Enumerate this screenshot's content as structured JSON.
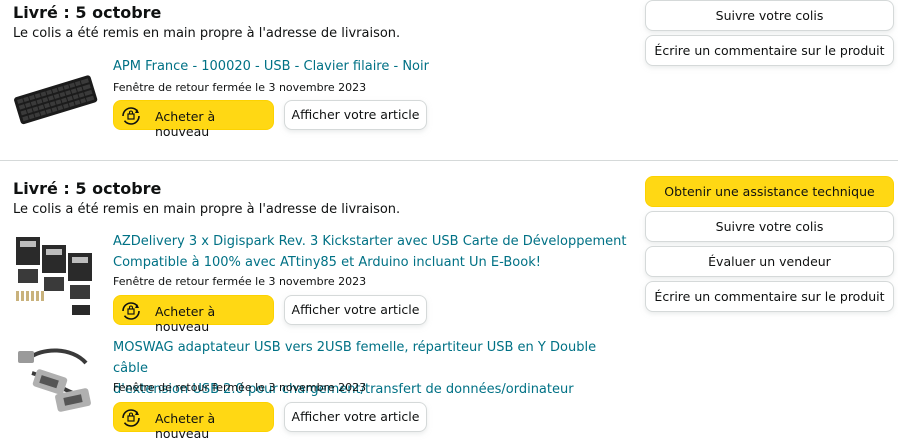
{
  "orders": [
    {
      "status": "Livré : 5 octobre",
      "status_sub": "Le colis a été remis en main propre à l'adresse de livraison.",
      "items": [
        {
          "title": "APM France - 100020 - USB - Clavier filaire - Noir",
          "return_window": "Fenêtre de retour fermée le 3 novembre 2023",
          "buy_again": "Acheter à nouveau",
          "view_item": "Afficher votre article"
        }
      ],
      "actions": [
        "Suivre votre colis",
        "Écrire un commentaire sur le produit"
      ]
    },
    {
      "status": "Livré : 5 octobre",
      "status_sub": "Le colis a été remis en main propre à l'adresse de livraison.",
      "items": [
        {
          "title_line1": "AZDelivery 3 x Digispark Rev. 3 Kickstarter avec USB Carte de Développement",
          "title_line2": "Compatible à 100% avec ATtiny85 et Arduino incluant Un E-Book!",
          "return_window": "Fenêtre de retour fermée le 3 novembre 2023",
          "buy_again": "Acheter à nouveau",
          "view_item": "Afficher votre article"
        },
        {
          "title_line1": "MOSWAG adaptateur USB vers 2USB femelle, répartiteur USB en Y Double câble",
          "title_line2": "d'extension USB 2.0 pour chargement/transfert de données/ordinateur",
          "return_window": "Fenêtre de retour fermée le 3 novembre 2023",
          "buy_again": "Acheter à nouveau",
          "view_item": "Afficher votre article"
        }
      ],
      "actions": [
        "Obtenir une assistance technique",
        "Suivre votre colis",
        "Évaluer un vendeur",
        "Écrire un commentaire sur le produit"
      ]
    }
  ],
  "colors": {
    "accent": "#ffd814",
    "link": "#007185",
    "border": "#d5d9d9"
  },
  "icons": {
    "buy_again": "buy-again-cycle-icon"
  }
}
